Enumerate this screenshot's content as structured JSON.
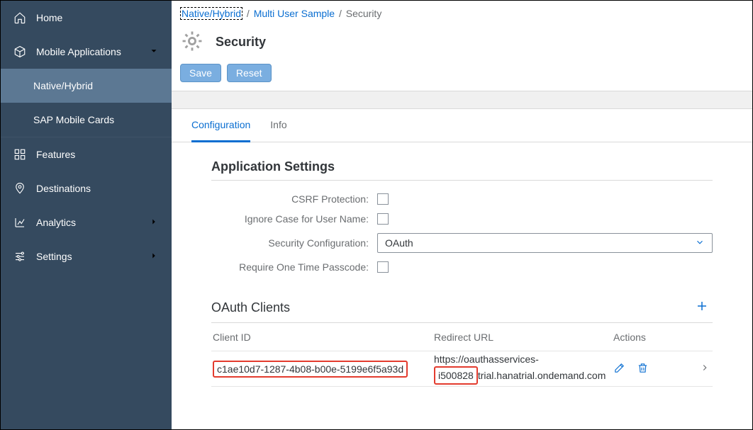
{
  "sidebar": {
    "items": [
      {
        "label": "Home"
      },
      {
        "label": "Mobile Applications",
        "expanded": true,
        "children": [
          {
            "label": "Native/Hybrid",
            "active": true
          },
          {
            "label": "SAP Mobile Cards"
          }
        ]
      },
      {
        "label": "Features"
      },
      {
        "label": "Destinations"
      },
      {
        "label": "Analytics"
      },
      {
        "label": "Settings"
      }
    ]
  },
  "breadcrumb": {
    "a": "Native/Hybrid",
    "b": "Multi User Sample",
    "c": "Security",
    "sep": "/"
  },
  "page": {
    "title": "Security"
  },
  "actions": {
    "save": "Save",
    "reset": "Reset"
  },
  "tabs": {
    "configuration": "Configuration",
    "info": "Info"
  },
  "appSettings": {
    "title": "Application Settings",
    "csrf_label": "CSRF Protection:",
    "ignore_case_label": "Ignore Case for User Name:",
    "security_config_label": "Security Configuration:",
    "security_config_value": "OAuth",
    "otp_label": "Require One Time Passcode:"
  },
  "oauth": {
    "title": "OAuth Clients",
    "cols": {
      "client_id": "Client ID",
      "redirect_url": "Redirect URL",
      "actions": "Actions"
    },
    "rows": [
      {
        "client_id": "c1ae10d7-1287-4b08-b00e-5199e6f5a93d",
        "redirect_prefix": "https://oauthasservices-",
        "redirect_highlight": "i500828",
        "redirect_suffix": "trial.hanatrial.ondemand.com"
      }
    ]
  }
}
